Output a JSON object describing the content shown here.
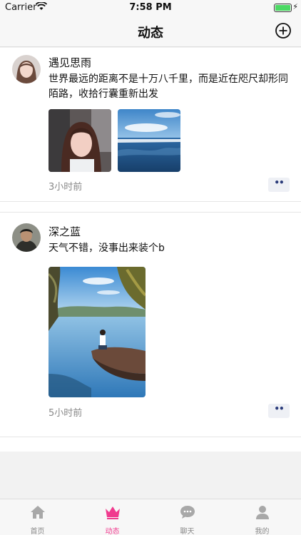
{
  "status_bar": {
    "carrier": "Carrier",
    "time": "7:58 PM"
  },
  "nav": {
    "title": "动态"
  },
  "posts": [
    {
      "author": "遇见思雨",
      "text": "世界最远的距离不是十万八千里，而是近在咫尺却形同陌路，收拾行囊重新出发",
      "time": "3小时前",
      "more": "••"
    },
    {
      "author": "深之蓝",
      "text": "天气不错，没事出来装个b",
      "time": "5小时前",
      "more": "••"
    }
  ],
  "tabs": [
    {
      "label": "首页",
      "icon": "home-icon",
      "active": false
    },
    {
      "label": "动态",
      "icon": "crown-icon",
      "active": true
    },
    {
      "label": "聊天",
      "icon": "chat-bubble-icon",
      "active": false
    },
    {
      "label": "我的",
      "icon": "person-icon",
      "active": false
    }
  ],
  "colors": {
    "accent": "#f03a8e",
    "inactive": "#8a8a8a"
  }
}
